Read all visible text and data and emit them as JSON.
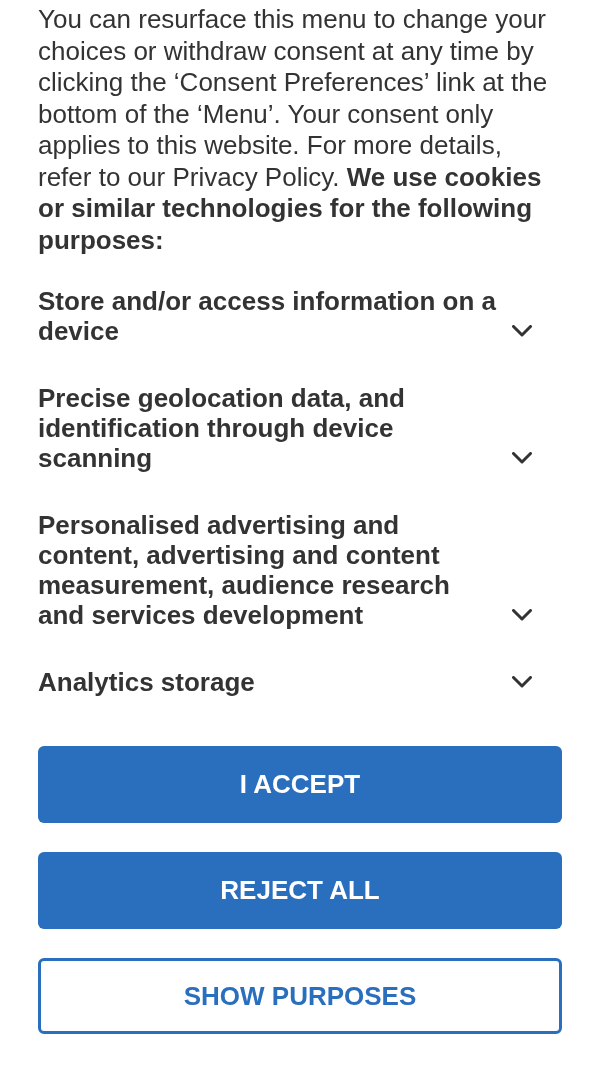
{
  "intro": {
    "text": "You can resurface this menu to change your choices or withdraw consent at any time by clicking the ‘Consent Preferences’ link at the bottom of the ‘Menu’. Your consent only applies to this website. For more details, refer to our Privacy Policy. **We use cookies or similar technologies for the following purposes:**"
  },
  "purposes": [
    {
      "title": "Store and/or access information on a device",
      "expanded": false
    },
    {
      "title": "Precise geolocation data, and identification through device scanning",
      "expanded": false
    },
    {
      "title": "Personalised advertising and content, advertising and content measurement, audience research and services development",
      "expanded": false
    },
    {
      "title": "Analytics storage",
      "expanded": false
    }
  ],
  "buttons": [
    {
      "label": "I ACCEPT",
      "kind": "primary"
    },
    {
      "label": "REJECT ALL",
      "kind": "primary"
    },
    {
      "label": "SHOW PURPOSES",
      "kind": "outline"
    }
  ]
}
